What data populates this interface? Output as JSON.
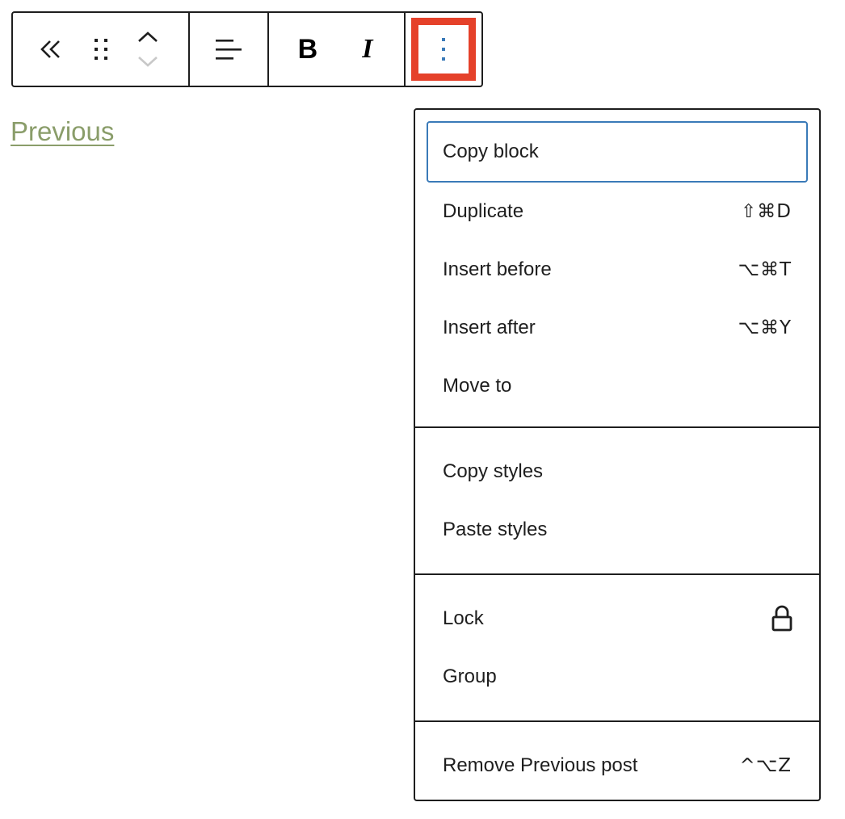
{
  "toolbar": {
    "parent_label": "Select parent block",
    "drag_label": "Drag",
    "move_up_label": "Move up",
    "move_down_label": "Move down",
    "align_label": "Align text",
    "bold_label": "B",
    "italic_label": "I",
    "options_label": "Options"
  },
  "content": {
    "link_text": "Previous"
  },
  "menu": {
    "sections": [
      {
        "items": [
          {
            "label": "Copy block",
            "shortcut": ""
          },
          {
            "label": "Duplicate",
            "shortcut": "⇧⌘D"
          },
          {
            "label": "Insert before",
            "shortcut": "⌥⌘T"
          },
          {
            "label": "Insert after",
            "shortcut": "⌥⌘Y"
          },
          {
            "label": "Move to",
            "shortcut": ""
          }
        ]
      },
      {
        "items": [
          {
            "label": "Copy styles"
          },
          {
            "label": "Paste styles"
          }
        ]
      },
      {
        "items": [
          {
            "label": "Lock",
            "icon": "lock-icon"
          },
          {
            "label": "Group"
          }
        ]
      },
      {
        "items": [
          {
            "label": "Remove Previous post",
            "shortcut": "^⌥Z"
          }
        ]
      }
    ]
  },
  "colors": {
    "highlight": "#e5412a",
    "focus": "#3a7ab8",
    "link": "#8a9d6a",
    "more_dots": "#3a7ab8"
  }
}
